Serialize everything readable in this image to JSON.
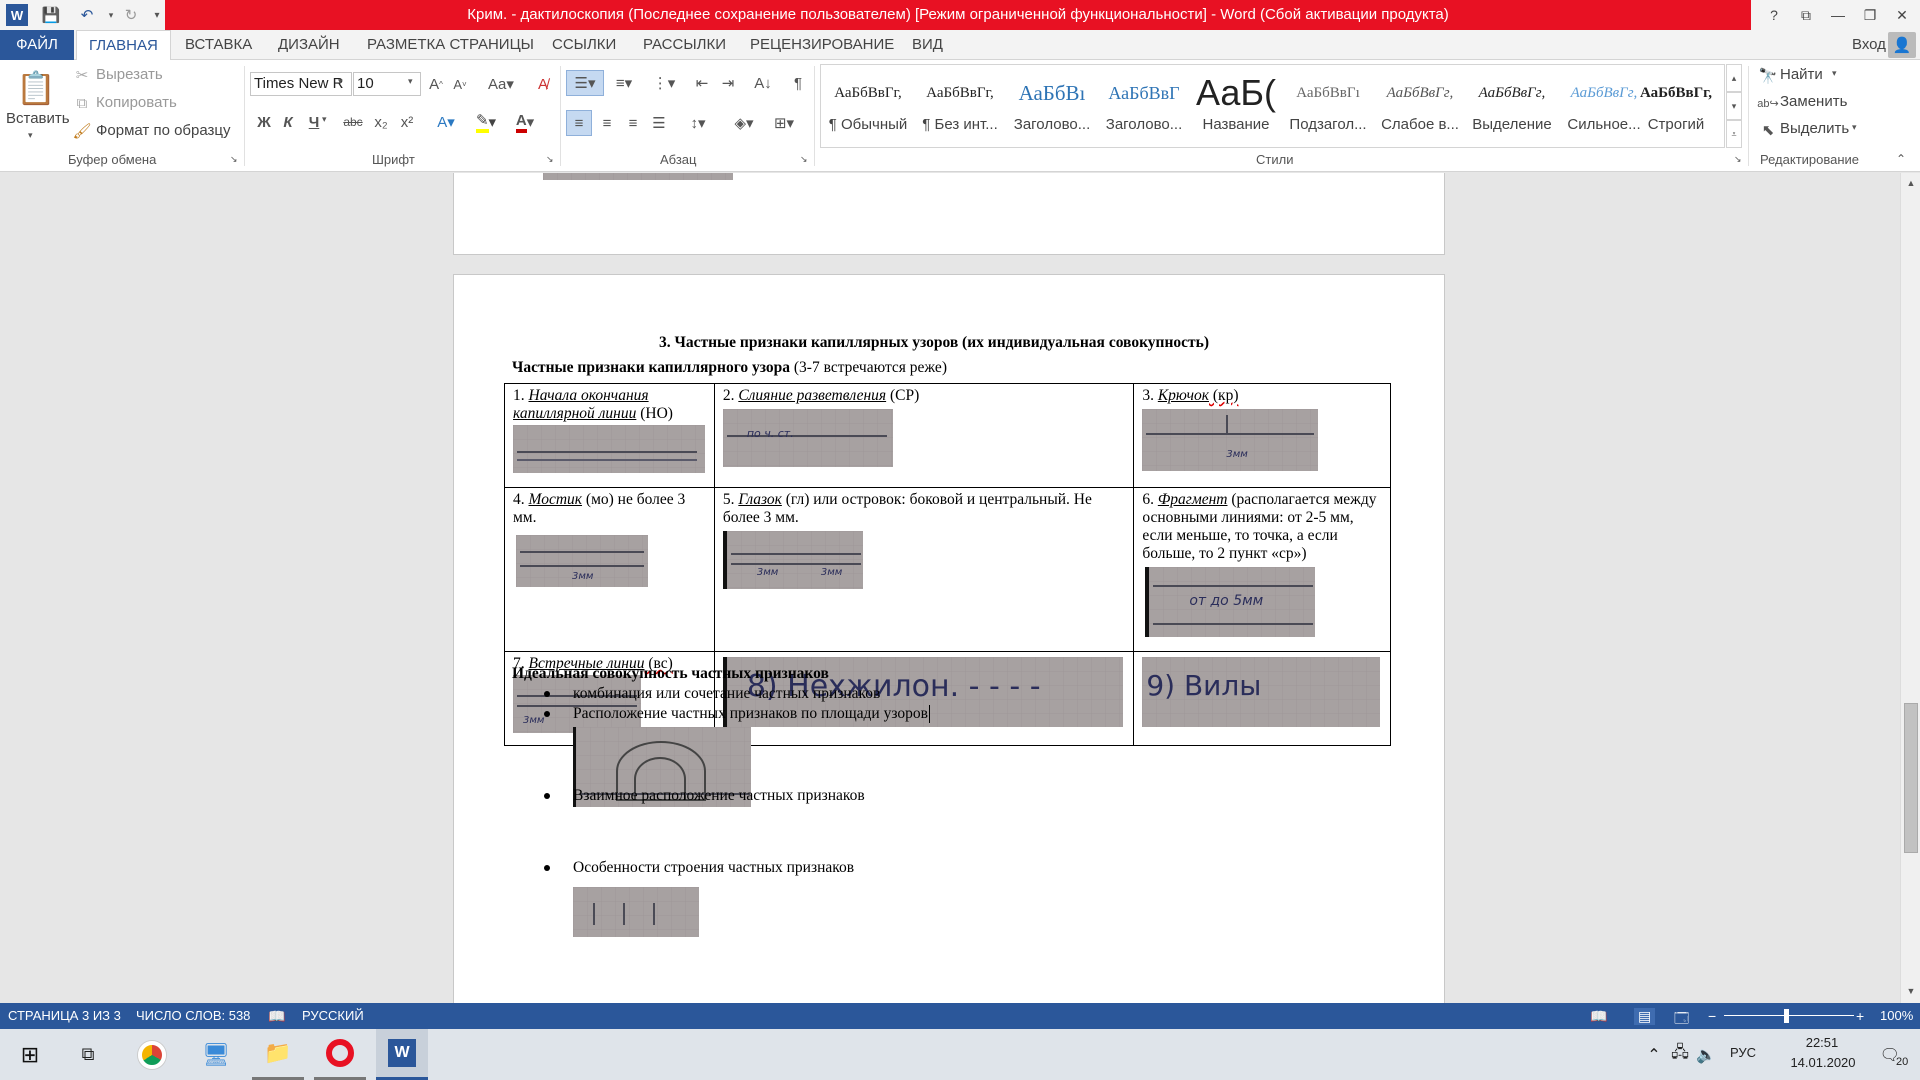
{
  "window": {
    "title": "Крим. - дактилоскопия (Последнее сохранение пользователем) [Режим ограниченной функциональности] -  Word (Сбой активации продукта)",
    "help": "?",
    "minimize": "—",
    "restore": "❐",
    "close": "✕"
  },
  "tabs": {
    "file": "ФАЙЛ",
    "items": [
      "ГЛАВНАЯ",
      "ВСТАВКА",
      "ДИЗАЙН",
      "РАЗМЕТКА СТРАНИЦЫ",
      "ССЫЛКИ",
      "РАССЫЛКИ",
      "РЕЦЕНЗИРОВАНИЕ",
      "ВИД"
    ],
    "signin": "Вход"
  },
  "ribbon": {
    "clipboard": {
      "paste": "Вставить",
      "cut": "Вырезать",
      "copy": "Копировать",
      "format_painter": "Формат по образцу",
      "label": "Буфер обмена"
    },
    "font": {
      "name": "Times New R",
      "size": "10",
      "label": "Шрифт",
      "bold": "Ж",
      "italic": "К",
      "underline": "Ч",
      "strike": "abc",
      "sub": "x₂",
      "sup": "x²"
    },
    "paragraph": {
      "label": "Абзац"
    },
    "styles": {
      "label": "Стили",
      "items": [
        {
          "sample": "АаБбВвГг,",
          "name": "¶ Обычный"
        },
        {
          "sample": "АаБбВвГг,",
          "name": "¶ Без инт..."
        },
        {
          "sample": "АаБбВı",
          "name": "Заголово..."
        },
        {
          "sample": "АаБбВвГ",
          "name": "Заголово..."
        },
        {
          "sample": "АаБ(",
          "name": "Название"
        },
        {
          "sample": "АаБбВвГı",
          "name": "Подзагол..."
        },
        {
          "sample": "АаБбВвГг,",
          "name": "Слабое в..."
        },
        {
          "sample": "АаБбВвГг,",
          "name": "Выделение"
        },
        {
          "sample": "АаБбВвГг,",
          "name": "Сильное..."
        },
        {
          "sample": "АаБбВвГг,",
          "name": "Строгий"
        }
      ]
    },
    "editing": {
      "find": "Найти",
      "replace": "Заменить",
      "select": "Выделить",
      "label": "Редактирование"
    }
  },
  "document": {
    "heading": "3.    Частные признаки капиллярных узоров (их индивидуальная совокупность)",
    "subheading_bold": "Частные признаки капиллярного узора",
    "subheading_rest": " (3-7 встречаются реже)",
    "cells": [
      {
        "num": "1. ",
        "term": "Начала окончания капиллярной линии",
        "rest": " (НО)"
      },
      {
        "num": "2. ",
        "term": "Слияние разветвления",
        "rest": " (СР)"
      },
      {
        "num": "3. ",
        "term": "Крючок",
        "rest": " (кр)"
      },
      {
        "num": "4. ",
        "term": "Мостик",
        "rest": " (мо) не более 3 мм."
      },
      {
        "num": "5. ",
        "term": "Глазок",
        "rest": " (гл) или островок: боковой и центральный. Не более 3 мм."
      },
      {
        "num": "6. ",
        "term": "Фрагмент",
        "rest": " (располагается между основными линиями: от 2-5 мм, если меньше, то точка, а если больше, то 2 пункт «ср»)"
      },
      {
        "num": "7. ",
        "term": "Встречные линии",
        "rest": " (вс)"
      }
    ],
    "handwriting": {
      "c2": "по ч. ст.",
      "c3": "3мм",
      "c4": "3мм",
      "c5a": "3мм",
      "c5b": "3мм",
      "c6": "от до 5мм",
      "c7": "3мм",
      "c8": "8) Нехжилон. - - - -",
      "c9": "9) Вилы"
    },
    "ideal_title": "Идеальная совокупность частных признаков",
    "bullets": [
      "комбинация или сочетание частных признаков",
      "Расположение частных признаков по площади узоров",
      "Взаимное расположение частных признаков",
      "Особенности строения частных признаков"
    ]
  },
  "status": {
    "page": "СТРАНИЦА 3 ИЗ 3",
    "words": "ЧИСЛО СЛОВ: 538",
    "lang": "РУССКИЙ",
    "zoom": "100%"
  },
  "taskbar": {
    "lang": "РУС",
    "time": "22:51",
    "date": "14.01.2020",
    "notif": "20"
  }
}
